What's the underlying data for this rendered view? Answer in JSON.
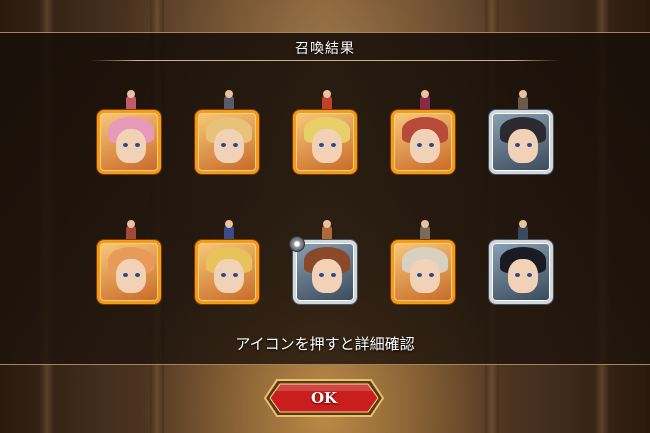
{
  "header": {
    "title": "召喚結果"
  },
  "units": [
    {
      "frame": "gold",
      "hair": "#e79ab8",
      "sprite": "#c05a6a",
      "badge": false
    },
    {
      "frame": "gold",
      "hair": "#e6c27a",
      "sprite": "#5a5a6a",
      "badge": false
    },
    {
      "frame": "gold",
      "hair": "#e8cf6a",
      "sprite": "#c0402a",
      "badge": false
    },
    {
      "frame": "gold",
      "hair": "#b84a3a",
      "sprite": "#8a2a4a",
      "badge": false
    },
    {
      "frame": "silver",
      "hair": "#2a2a30",
      "sprite": "#6a5a4a",
      "badge": false
    },
    {
      "frame": "gold",
      "hair": "#e89a5a",
      "sprite": "#a04a3a",
      "badge": false
    },
    {
      "frame": "gold",
      "hair": "#e8c25a",
      "sprite": "#3a4a8a",
      "badge": false
    },
    {
      "frame": "silver",
      "hair": "#8a4a2a",
      "sprite": "#b06a3a",
      "badge": true
    },
    {
      "frame": "gold",
      "hair": "#d8d0c0",
      "sprite": "#7a6a5a",
      "badge": false
    },
    {
      "frame": "silver",
      "hair": "#1a1a22",
      "sprite": "#3a4a5a",
      "badge": false
    }
  ],
  "hint": {
    "text": "アイコンを押すと詳細確認"
  },
  "ok_button": {
    "label": "OK"
  },
  "colors": {
    "gold_frame": "#f39a1a",
    "silver_frame": "#cfd6de",
    "button_red": "#c81e1e"
  }
}
